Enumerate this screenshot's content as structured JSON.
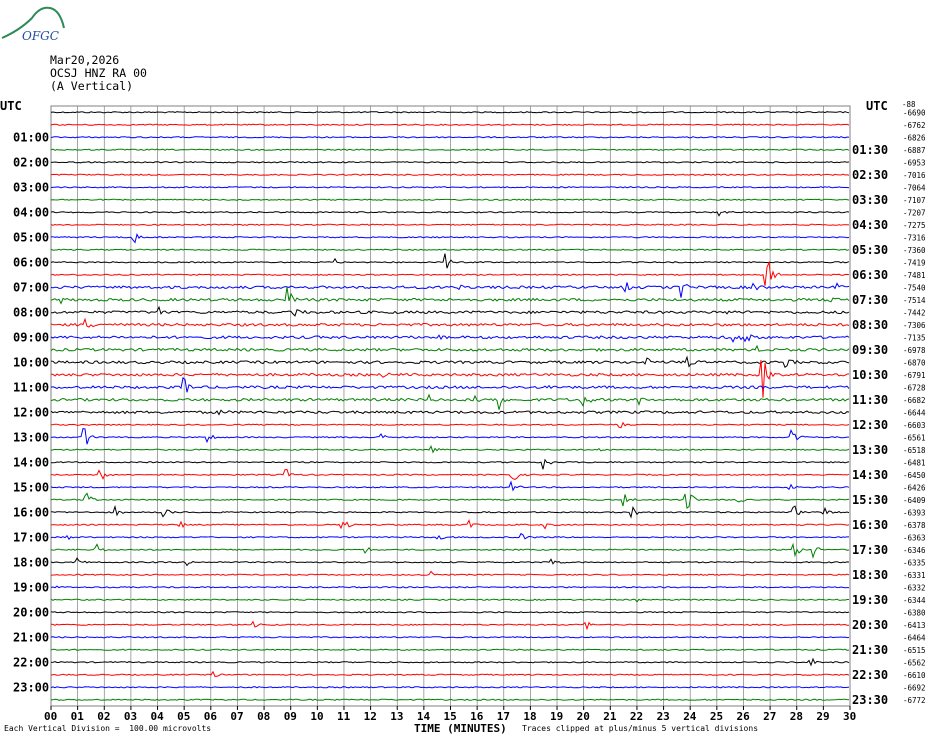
{
  "logo": {
    "text": "OFGC",
    "icon": "ofgc-mountain-logo"
  },
  "header": {
    "date": "Mar20,2026",
    "station": "OCSJ HNZ RA 00",
    "component": "(A Vertical)"
  },
  "left_axis_title": "UTC",
  "right_axis_title": "UTC",
  "corner_label": "-88",
  "footer": {
    "scale_note": "Each Vertical Division =  100.00 microvolts",
    "x_title": "TIME (MINUTES)",
    "clip_note": "Traces clipped at plus/minus 5 vertical divisions"
  },
  "colors": {
    "cycle": [
      "#000000",
      "#ff0000",
      "#0000ff",
      "#008000"
    ],
    "grid": "#808080"
  },
  "chart_data": {
    "type": "line",
    "title": "",
    "xlabel": "TIME (MINUTES)",
    "xlim": [
      0,
      30
    ],
    "x_ticks": [
      "00",
      "01",
      "02",
      "03",
      "04",
      "05",
      "06",
      "07",
      "08",
      "09",
      "10",
      "11",
      "12",
      "13",
      "14",
      "15",
      "16",
      "17",
      "18",
      "19",
      "20",
      "21",
      "22",
      "23",
      "24",
      "25",
      "26",
      "27",
      "28",
      "29",
      "30"
    ],
    "rows": 48,
    "left_hour_labels": [
      "01:00",
      "02:00",
      "03:00",
      "04:00",
      "05:00",
      "06:00",
      "07:00",
      "08:00",
      "09:00",
      "10:00",
      "11:00",
      "12:00",
      "13:00",
      "14:00",
      "15:00",
      "16:00",
      "17:00",
      "18:00",
      "19:00",
      "20:00",
      "21:00",
      "22:00",
      "23:00"
    ],
    "right_hour_labels": [
      "01:30",
      "02:30",
      "03:30",
      "04:30",
      "05:30",
      "06:30",
      "07:30",
      "08:30",
      "09:30",
      "10:30",
      "11:30",
      "12:30",
      "13:30",
      "14:30",
      "15:30",
      "16:30",
      "17:30",
      "18:30",
      "19:30",
      "20:30",
      "21:30",
      "22:30",
      "23:30"
    ],
    "row_offsets": [
      "-6690",
      "-6762",
      "-6826",
      "-6887",
      "-6953",
      "-7016",
      "-7064",
      "-7107",
      "-7207",
      "-7275",
      "-7316",
      "-7360",
      "-7419",
      "-7481",
      "-7540",
      "-7514",
      "-7442",
      "-7306",
      "-7135",
      "-6978",
      "-6870",
      "-6791",
      "-6728",
      "-6682",
      "-6644",
      "-6603",
      "-6561",
      "-6518",
      "-6481",
      "-6450",
      "-6426",
      "-6409",
      "-6393",
      "-6378",
      "-6363",
      "-6346",
      "-6335",
      "-6331",
      "-6332",
      "-6344",
      "-6380",
      "-6413",
      "-6464",
      "-6515",
      "-6562",
      "-6610",
      "-6692",
      "-6772"
    ],
    "events": [
      {
        "row": 8,
        "t": 25.1,
        "a": 5
      },
      {
        "row": 10,
        "t": 3.1,
        "a": 8
      },
      {
        "row": 12,
        "t": 10.6,
        "a": 6
      },
      {
        "row": 12,
        "t": 14.8,
        "a": 9
      },
      {
        "row": 13,
        "t": 26.9,
        "a": 28
      },
      {
        "row": 13,
        "t": 26.8,
        "a": 14
      },
      {
        "row": 14,
        "t": 15.2,
        "a": 7
      },
      {
        "row": 14,
        "t": 21.6,
        "a": 6
      },
      {
        "row": 14,
        "t": 23.7,
        "a": 11
      },
      {
        "row": 14,
        "t": 26.4,
        "a": 10
      },
      {
        "row": 14,
        "t": 29.5,
        "a": 12
      },
      {
        "row": 15,
        "t": 0.4,
        "a": 3
      },
      {
        "row": 15,
        "t": 8.9,
        "a": 14
      },
      {
        "row": 15,
        "t": 29.2,
        "a": 4
      },
      {
        "row": 16,
        "t": 4.1,
        "a": 6
      },
      {
        "row": 16,
        "t": 9.1,
        "a": 7
      },
      {
        "row": 16,
        "t": 25.4,
        "a": 4
      },
      {
        "row": 17,
        "t": 1.3,
        "a": 7
      },
      {
        "row": 18,
        "t": 14.5,
        "a": 5
      },
      {
        "row": 18,
        "t": 25.6,
        "a": 10
      },
      {
        "row": 18,
        "t": 26.1,
        "a": 7
      },
      {
        "row": 19,
        "t": 26.5,
        "a": 9
      },
      {
        "row": 20,
        "t": 22.3,
        "a": 8
      },
      {
        "row": 20,
        "t": 23.9,
        "a": 9
      },
      {
        "row": 20,
        "t": 27.6,
        "a": 6
      },
      {
        "row": 21,
        "t": 26.7,
        "a": 32
      },
      {
        "row": 21,
        "t": 12.5,
        "a": 4
      },
      {
        "row": 22,
        "t": 5.0,
        "a": 13
      },
      {
        "row": 22,
        "t": 18.6,
        "a": 4
      },
      {
        "row": 23,
        "t": 14.2,
        "a": 6
      },
      {
        "row": 23,
        "t": 15.9,
        "a": 10
      },
      {
        "row": 23,
        "t": 16.8,
        "a": 14
      },
      {
        "row": 23,
        "t": 19.9,
        "a": 16
      },
      {
        "row": 23,
        "t": 22.0,
        "a": 9
      },
      {
        "row": 24,
        "t": 6.3,
        "a": 4
      },
      {
        "row": 25,
        "t": 21.3,
        "a": 8
      },
      {
        "row": 26,
        "t": 1.2,
        "a": 18
      },
      {
        "row": 26,
        "t": 5.9,
        "a": 7
      },
      {
        "row": 26,
        "t": 12.3,
        "a": 9
      },
      {
        "row": 26,
        "t": 27.8,
        "a": 13
      },
      {
        "row": 27,
        "t": 14.3,
        "a": 7
      },
      {
        "row": 27,
        "t": 20.5,
        "a": 3
      },
      {
        "row": 28,
        "t": 18.5,
        "a": 8
      },
      {
        "row": 29,
        "t": 1.8,
        "a": 10
      },
      {
        "row": 29,
        "t": 8.8,
        "a": 8
      },
      {
        "row": 29,
        "t": 17.3,
        "a": 14
      },
      {
        "row": 30,
        "t": 17.2,
        "a": 10
      },
      {
        "row": 30,
        "t": 27.7,
        "a": 8
      },
      {
        "row": 31,
        "t": 1.3,
        "a": 9
      },
      {
        "row": 31,
        "t": 21.5,
        "a": 11
      },
      {
        "row": 31,
        "t": 23.8,
        "a": 24
      },
      {
        "row": 31,
        "t": 25.8,
        "a": 6
      },
      {
        "row": 32,
        "t": 2.4,
        "a": 6
      },
      {
        "row": 32,
        "t": 4.2,
        "a": 6
      },
      {
        "row": 32,
        "t": 21.8,
        "a": 6
      },
      {
        "row": 32,
        "t": 27.9,
        "a": 8
      },
      {
        "row": 32,
        "t": 29.0,
        "a": 6
      },
      {
        "row": 33,
        "t": 4.8,
        "a": 5
      },
      {
        "row": 33,
        "t": 10.9,
        "a": 9
      },
      {
        "row": 33,
        "t": 15.7,
        "a": 5
      },
      {
        "row": 33,
        "t": 17.5,
        "a": 4
      },
      {
        "row": 33,
        "t": 18.5,
        "a": 6
      },
      {
        "row": 33,
        "t": 28.0,
        "a": 4
      },
      {
        "row": 34,
        "t": 0.6,
        "a": 3
      },
      {
        "row": 34,
        "t": 14.5,
        "a": 6
      },
      {
        "row": 34,
        "t": 17.6,
        "a": 10
      },
      {
        "row": 35,
        "t": 1.7,
        "a": 7
      },
      {
        "row": 35,
        "t": 11.8,
        "a": 6
      },
      {
        "row": 35,
        "t": 27.9,
        "a": 12
      },
      {
        "row": 35,
        "t": 28.6,
        "a": 8
      },
      {
        "row": 36,
        "t": 1.0,
        "a": 6
      },
      {
        "row": 36,
        "t": 5.1,
        "a": 6
      },
      {
        "row": 36,
        "t": 18.8,
        "a": 5
      },
      {
        "row": 37,
        "t": 14.3,
        "a": 5
      },
      {
        "row": 38,
        "t": 0.1,
        "a": 3
      },
      {
        "row": 39,
        "t": 22.0,
        "a": 4
      },
      {
        "row": 41,
        "t": 7.5,
        "a": 5
      },
      {
        "row": 41,
        "t": 20.1,
        "a": 6
      },
      {
        "row": 44,
        "t": 28.5,
        "a": 6
      },
      {
        "row": 45,
        "t": 6.1,
        "a": 5
      }
    ]
  }
}
